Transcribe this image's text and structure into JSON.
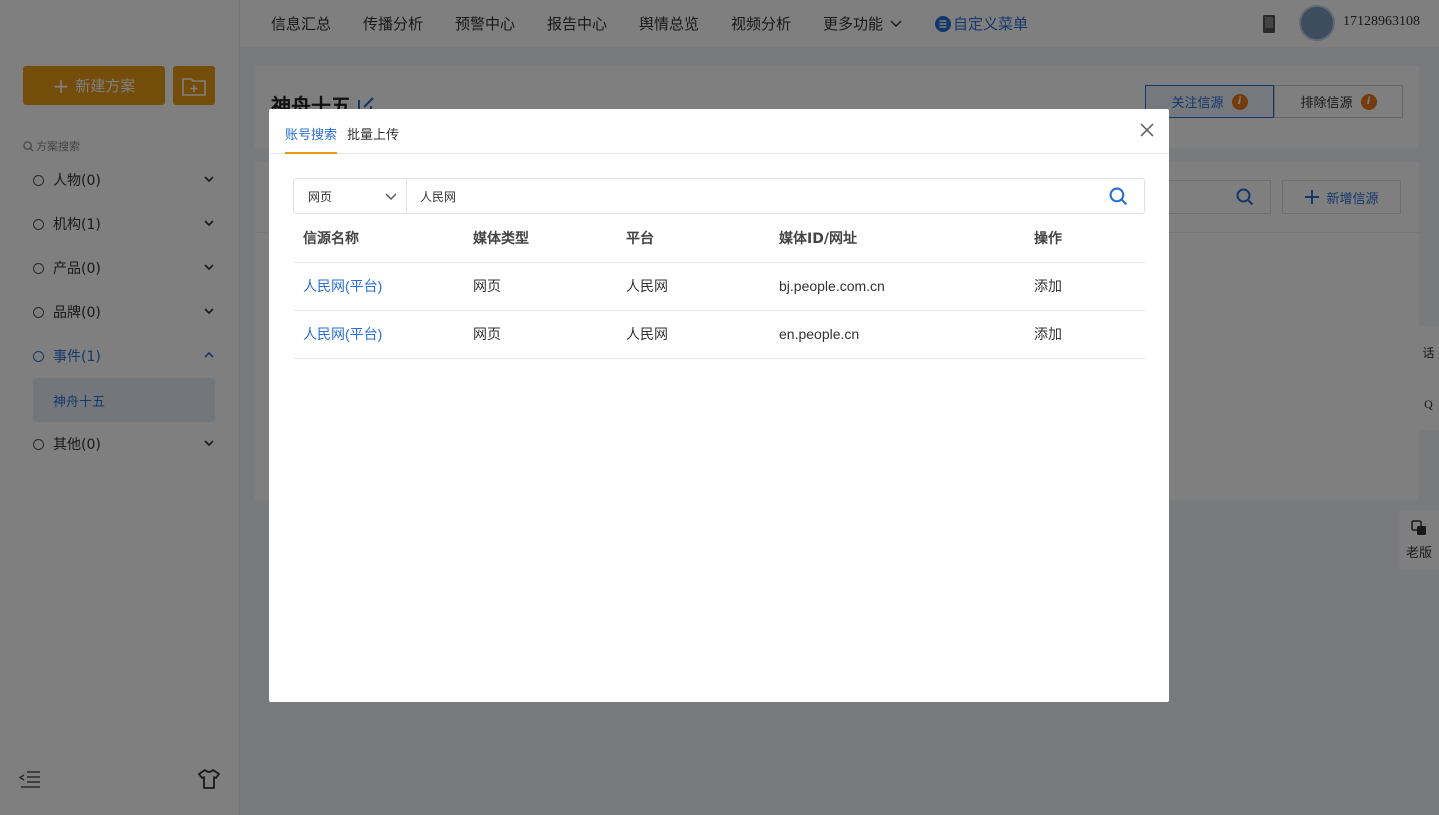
{
  "sidebar": {
    "new_plan_label": "新建方案",
    "search_label": "方案搜索",
    "categories": [
      {
        "label": "人物(0)"
      },
      {
        "label": "机构(1)"
      },
      {
        "label": "产品(0)"
      },
      {
        "label": "品牌(0)"
      },
      {
        "label": "事件(1)"
      },
      {
        "label": "其他(0)"
      }
    ],
    "active_sub_item": "神舟十五"
  },
  "topnav": {
    "items": [
      "信息汇总",
      "传播分析",
      "预警中心",
      "报告中心",
      "舆情总览",
      "视频分析",
      "更多功能"
    ],
    "custom_menu": "自定义菜单",
    "username": "17128963108"
  },
  "main": {
    "title": "神舟十五",
    "follow_source_label": "关注信源",
    "exclude_source_label": "排除信源",
    "add_source_label": "新增信源",
    "side_float": [
      "话",
      "Q"
    ],
    "old_version_label": "老版"
  },
  "modal": {
    "tabs": [
      "账号搜索",
      "批量上传"
    ],
    "select_value": "网页",
    "search_value": "人民网",
    "columns": [
      "信源名称",
      "媒体类型",
      "平台",
      "媒体ID/网址",
      "操作"
    ],
    "rows": [
      {
        "name": "人民网(平台)",
        "media_type": "网页",
        "platform": "人民网",
        "url": "bj.people.com.cn",
        "op": "添加"
      },
      {
        "name": "人民网(平台)",
        "media_type": "网页",
        "platform": "人民网",
        "url": "en.people.cn",
        "op": "添加"
      }
    ]
  },
  "colors": {
    "accent": "#2a6fd6",
    "brand_orange": "#e89a14"
  }
}
